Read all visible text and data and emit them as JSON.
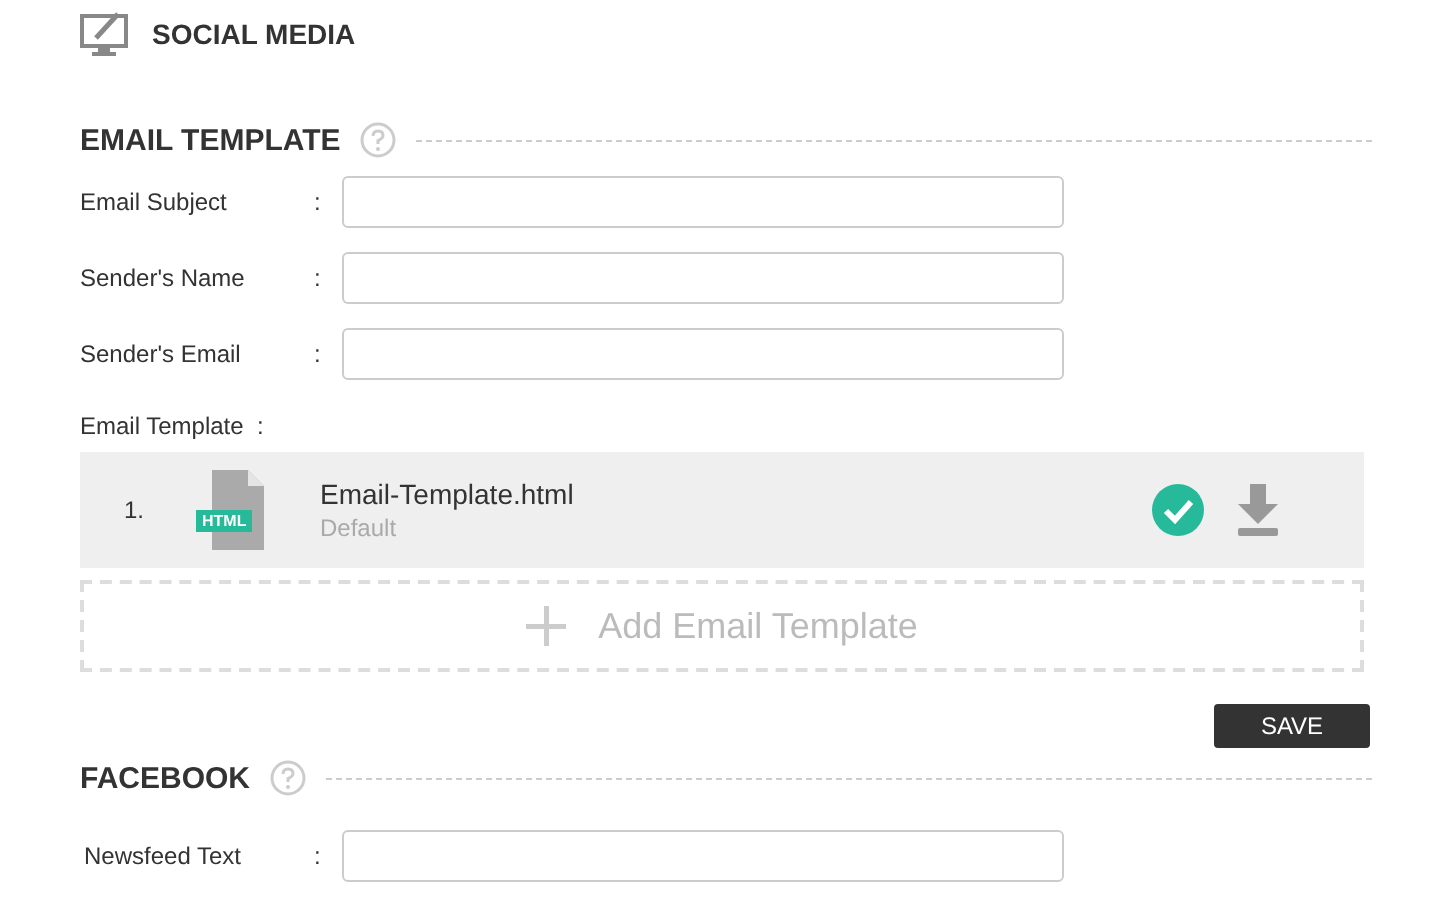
{
  "header": {
    "title": "SOCIAL MEDIA"
  },
  "email_section": {
    "title": "EMAIL TEMPLATE",
    "fields": [
      {
        "label": "Email Subject",
        "colon": ":"
      },
      {
        "label": "Sender's Name",
        "colon": ":"
      },
      {
        "label": "Sender's Email",
        "colon": ":"
      }
    ],
    "templates_label": "Email Template  :",
    "templates": [
      {
        "number": "1.",
        "badge": "HTML",
        "filename": "Email-Template.html",
        "subtitle": "Default"
      }
    ],
    "add_button": "Add Email Template",
    "save_button": "SAVE"
  },
  "facebook_section": {
    "title": "FACEBOOK",
    "fields": [
      {
        "label": "Newsfeed Text",
        "colon": ":"
      }
    ]
  }
}
